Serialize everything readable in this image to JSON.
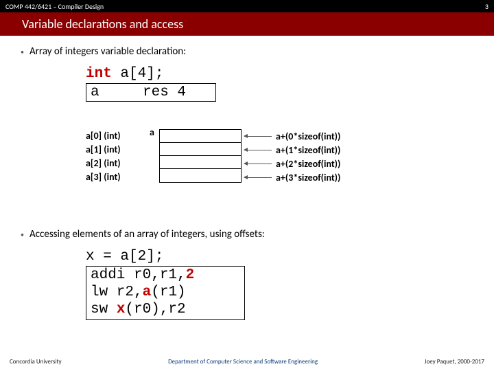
{
  "header": {
    "course": "COMP 442/6421 – Compiler Design",
    "page": "3"
  },
  "title": "Variable declarations and access",
  "bullet1": "Array of integers variable declaration:",
  "decl": {
    "kw": "int",
    "rest": " a[4];"
  },
  "res": {
    "name": "a",
    "code": "res 4"
  },
  "diagram": {
    "a_label": "a",
    "left": [
      "a[0] (int)",
      "a[1] (int)",
      "a[2] (int)",
      "a[3] (int)"
    ],
    "right": [
      "a+(0*sizeof(int))",
      "a+(1*sizeof(int))",
      "a+(2*sizeof(int))",
      "a+(3*sizeof(int))"
    ]
  },
  "bullet2": "Accessing elements of an array of integers, using offsets:",
  "code2": {
    "line0": "x = a[2];",
    "l1a": "addi r0,r1,",
    "l1b": "2",
    "l2a": "lw r2,",
    "l2b": "a",
    "l2c": "(r1)",
    "l3a": "sw ",
    "l3b": "x",
    "l3c": "(r0),r2"
  },
  "footer": {
    "left": "Concordia University",
    "mid": "Department of Computer Science and Software Engineering",
    "right": "Joey Paquet, 2000-2017"
  }
}
